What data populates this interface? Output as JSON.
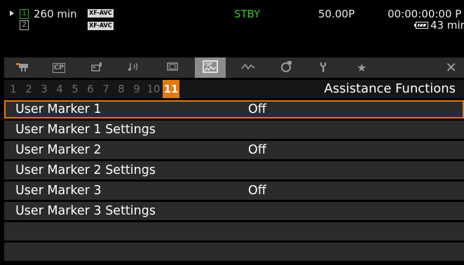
{
  "status": {
    "slot_a": "1",
    "slot_b": "2",
    "time_remaining": "260 min",
    "format_a": "XF-AVC",
    "format_b": "XF-AVC",
    "mode": "STBY",
    "frame_rate": "50.00P",
    "timecode": "00:00:00:00 P",
    "battery_remaining": "43 min"
  },
  "tabs": [
    {
      "icon": "camera-icon"
    },
    {
      "icon": "cp-icon",
      "label": "CP"
    },
    {
      "icon": "camera-settings-icon"
    },
    {
      "icon": "audio-icon"
    },
    {
      "icon": "monitor-icon"
    },
    {
      "icon": "assistance-functions-icon",
      "active": true
    },
    {
      "icon": "waveform-icon"
    },
    {
      "icon": "recording-media-icon"
    },
    {
      "icon": "wrench-icon"
    },
    {
      "icon": "star-icon"
    }
  ],
  "close_icon": "close-icon",
  "pages": [
    "1",
    "2",
    "3",
    "4",
    "5",
    "6",
    "7",
    "8",
    "9",
    "10",
    "11"
  ],
  "active_page": "11",
  "section_title": "Assistance Functions",
  "menu": [
    {
      "label": "User Marker 1",
      "value": "Off",
      "selected": true
    },
    {
      "label": "User Marker 1 Settings",
      "value": ""
    },
    {
      "label": "User Marker 2",
      "value": "Off"
    },
    {
      "label": "User Marker 2 Settings",
      "value": ""
    },
    {
      "label": "User Marker 3",
      "value": "Off"
    },
    {
      "label": "User Marker 3 Settings",
      "value": ""
    },
    {
      "label": "",
      "value": ""
    },
    {
      "label": "",
      "value": ""
    }
  ],
  "colors": {
    "accent": "#e27a12",
    "standby": "#3ebf3e",
    "background": "#000000",
    "row": "#2b2b2b"
  }
}
